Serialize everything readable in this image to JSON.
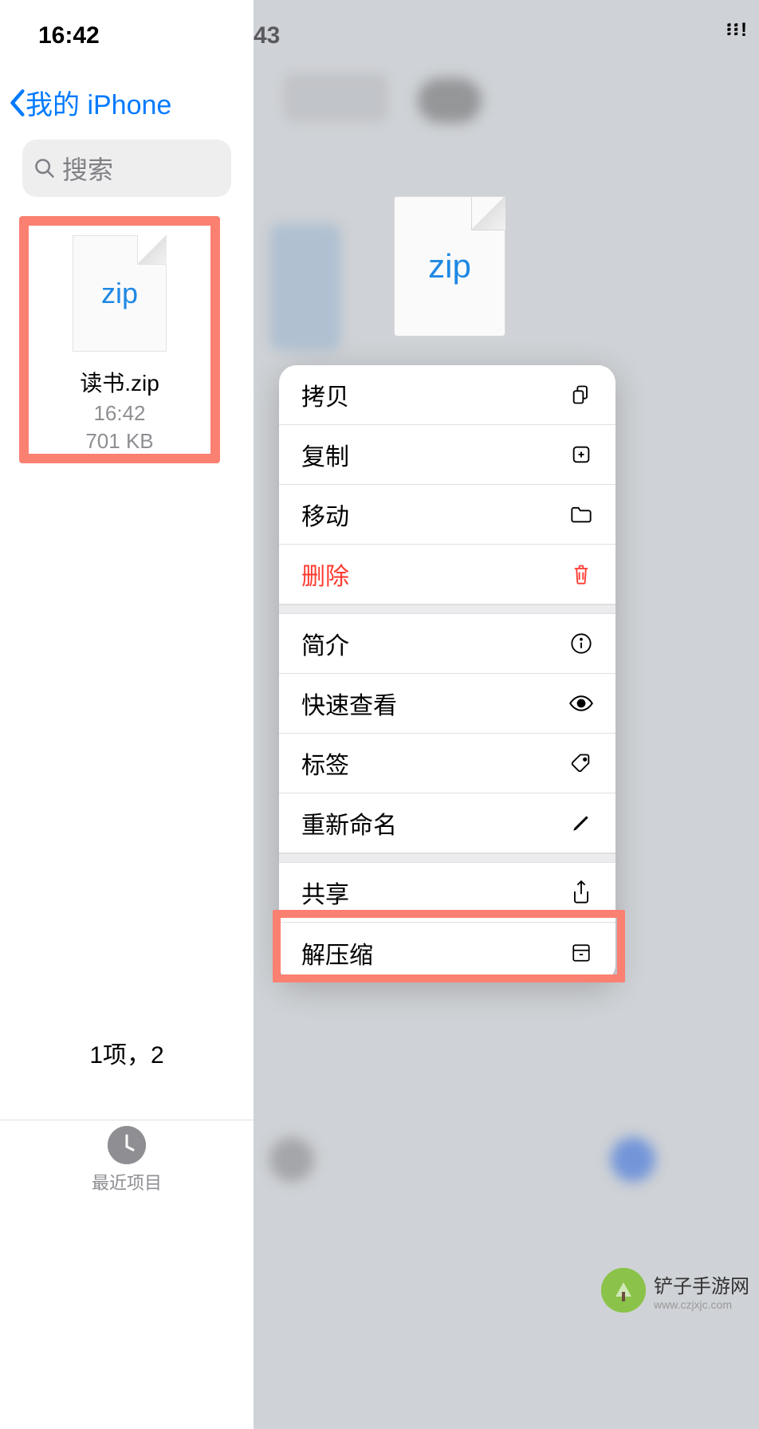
{
  "status_bar": {
    "time_left": "16:42",
    "time_right_partial": "43",
    "signal": "፧፧!"
  },
  "navigation": {
    "back_label": "我的 iPhone"
  },
  "search": {
    "placeholder": "搜索"
  },
  "file": {
    "icon_label": "zip",
    "name": "读书.zip",
    "time": "16:42",
    "size": "701 KB"
  },
  "preview": {
    "icon_label": "zip"
  },
  "context_menu": {
    "groups": [
      [
        {
          "label": "拷贝",
          "icon": "copy-doc-icon",
          "destructive": false
        },
        {
          "label": "复制",
          "icon": "duplicate-icon",
          "destructive": false
        },
        {
          "label": "移动",
          "icon": "folder-icon",
          "destructive": false
        },
        {
          "label": "删除",
          "icon": "trash-icon",
          "destructive": true
        }
      ],
      [
        {
          "label": "简介",
          "icon": "info-icon",
          "destructive": false
        },
        {
          "label": "快速查看",
          "icon": "eye-icon",
          "destructive": false
        },
        {
          "label": "标签",
          "icon": "tag-icon",
          "destructive": false
        },
        {
          "label": "重新命名",
          "icon": "pencil-icon",
          "destructive": false
        }
      ],
      [
        {
          "label": "共享",
          "icon": "share-icon",
          "destructive": false
        },
        {
          "label": "解压缩",
          "icon": "archive-icon",
          "destructive": false
        }
      ]
    ]
  },
  "footer": {
    "summary": "1项，2",
    "tab_label": "最近项目"
  },
  "watermark": {
    "line1": "铲子手游网",
    "line2": "www.czjxjc.com"
  }
}
